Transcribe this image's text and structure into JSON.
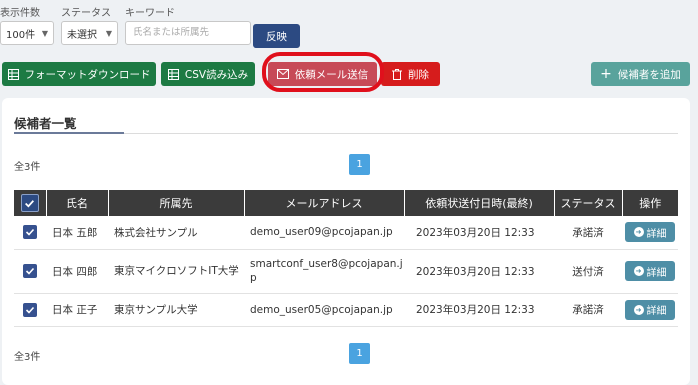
{
  "filters": {
    "count_label": "表示件数",
    "count_value": "100件",
    "status_label": "ステータス",
    "status_value": "未選択",
    "keyword_label": "キーワード",
    "keyword_placeholder": "氏名または所属先",
    "apply_label": "反映"
  },
  "toolbar": {
    "format_download": "フォーマットダウンロード",
    "csv_import": "CSV読み込み",
    "send_request": "依頼メール送信",
    "delete": "削除",
    "add_candidate": "候補者を追加"
  },
  "card": {
    "title": "候補者一覧",
    "total_top": "全3件",
    "total_bottom": "全3件",
    "page": "1"
  },
  "table": {
    "headers": [
      "氏名",
      "所属先",
      "メールアドレス",
      "依頼状送付日時(最終)",
      "ステータス",
      "操作"
    ],
    "rows": [
      {
        "name": "日本 五郎",
        "org": "株式会社サンプル",
        "email": "demo_user09@pcojapan.jp",
        "sent": "2023年03月20日 12:33",
        "status": "承諾済",
        "action": "詳細"
      },
      {
        "name": "日本 四郎",
        "org": "東京マイクロソフトIT大学",
        "email": "smartconf_user8@pcojapan.jp",
        "sent": "2023年03月20日 12:33",
        "status": "送付済",
        "action": "詳細"
      },
      {
        "name": "日本 正子",
        "org": "東京サンプル大学",
        "email": "demo_user05@pcojapan.jp",
        "sent": "2023年03月20日 12:33",
        "status": "承諾済",
        "action": "詳細"
      }
    ]
  },
  "colors": {
    "green": "#1d7a43",
    "red": "#d61c1c",
    "pink": "#c74a57",
    "teal": "#59a39c",
    "navy": "#2c4a82",
    "header": "#3b3b3b",
    "detail": "#4e8ea6",
    "pager": "#4aa3e0",
    "highlight": "#e0101c"
  },
  "icons": {
    "grid": "grid-icon",
    "mail": "mail-icon",
    "trash": "trash-icon",
    "plus": "plus-icon",
    "check": "check-icon",
    "arrow": "arrow-right-circle-icon"
  }
}
